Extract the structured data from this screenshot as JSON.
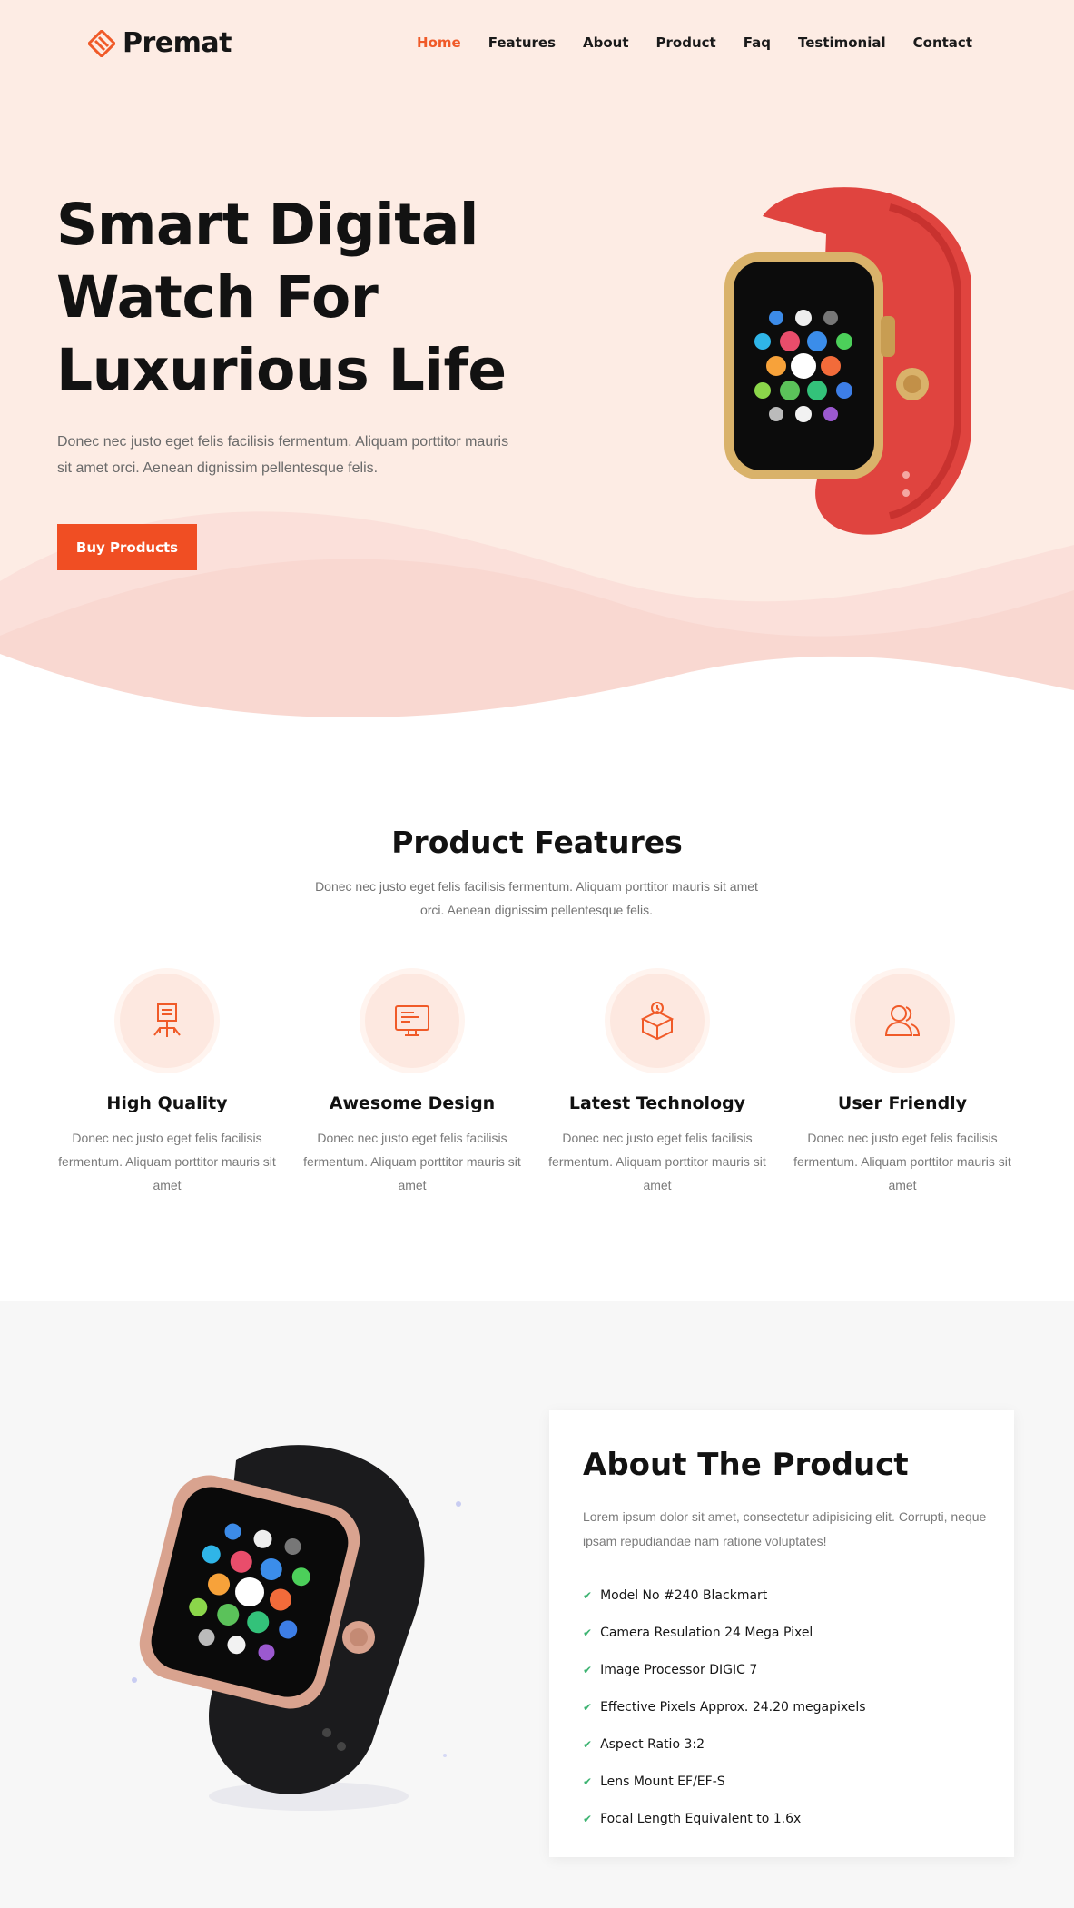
{
  "brand": {
    "name": "Premat",
    "accent": "#f05a28"
  },
  "nav": [
    {
      "label": "Home",
      "active": true
    },
    {
      "label": "Features"
    },
    {
      "label": "About"
    },
    {
      "label": "Product"
    },
    {
      "label": "Faq"
    },
    {
      "label": "Testimonial"
    },
    {
      "label": "Contact"
    }
  ],
  "hero": {
    "title_line1": "Smart Digital",
    "title_line2": "Watch For",
    "title_line3": "Luxurious Life",
    "text": "Donec nec justo eget felis facilisis fermentum. Aliquam porttitor mauris sit amet orci. Aenean dignissim pellentesque felis.",
    "button": "Buy Products"
  },
  "features": {
    "title": "Product Features",
    "text": "Donec nec justo eget felis facilisis fermentum. Aliquam porttitor mauris sit amet orci. Aenean dignissim pellentesque felis.",
    "items": [
      {
        "title": "High Quality",
        "text": "Donec nec justo eget felis facilisis fermentum. Aliquam porttitor mauris sit amet",
        "icon": "quality-icon"
      },
      {
        "title": "Awesome Design",
        "text": "Donec nec justo eget felis facilisis fermentum. Aliquam porttitor mauris sit amet",
        "icon": "monitor-icon"
      },
      {
        "title": "Latest Technology",
        "text": "Donec nec justo eget felis facilisis fermentum. Aliquam porttitor mauris sit amet",
        "icon": "box-icon"
      },
      {
        "title": "User Friendly",
        "text": "Donec nec justo eget felis facilisis fermentum. Aliquam porttitor mauris sit amet",
        "icon": "users-icon"
      }
    ]
  },
  "about": {
    "title": "About The Product",
    "text": "Lorem ipsum dolor sit amet, consectetur adipisicing elit. Corrupti, neque ipsam repudiandae nam ratione voluptates!",
    "specs": [
      "Model No #240 Blackmart",
      "Camera Resulation 24 Mega Pixel",
      "Image Processor DIGIC 7",
      "Effective Pixels Approx. 24.20 megapixels",
      "Aspect Ratio 3:2",
      "Lens Mount EF/EF-S",
      "Focal Length Equivalent to 1.6x"
    ]
  }
}
